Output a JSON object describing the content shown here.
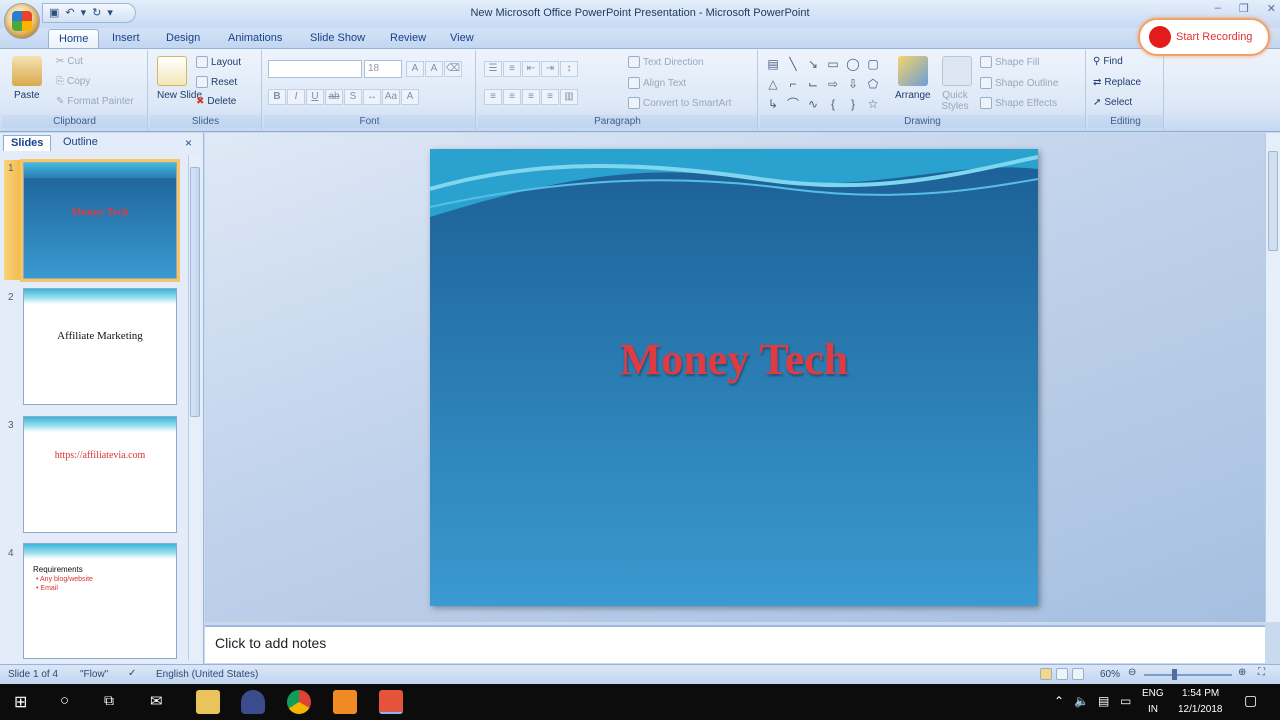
{
  "window": {
    "title": "New Microsoft Office PowerPoint Presentation - Microsoft PowerPoint"
  },
  "tabs": [
    "Home",
    "Insert",
    "Design",
    "Animations",
    "Slide Show",
    "Review",
    "View"
  ],
  "ribbon": {
    "clipboard": {
      "paste": "Paste",
      "cut": "Cut",
      "copy": "Copy",
      "format_painter": "Format Painter",
      "label": "Clipboard"
    },
    "slides": {
      "new_slide": "New Slide",
      "layout": "Layout",
      "reset": "Reset",
      "delete": "Delete",
      "label": "Slides"
    },
    "font": {
      "size": "18",
      "label": "Font"
    },
    "paragraph": {
      "text_direction": "Text Direction",
      "align_text": "Align Text",
      "convert_smartart": "Convert to SmartArt",
      "label": "Paragraph"
    },
    "drawing": {
      "arrange": "Arrange",
      "quick_styles": "Quick Styles",
      "shape_fill": "Shape Fill",
      "shape_outline": "Shape Outline",
      "shape_effects": "Shape Effects",
      "label": "Drawing"
    },
    "editing": {
      "find": "Find",
      "replace": "Replace",
      "select": "Select",
      "label": "Editing"
    }
  },
  "recording": {
    "label": "Start Recording"
  },
  "panel": {
    "tab_slides": "Slides",
    "tab_outline": "Outline"
  },
  "slides": [
    {
      "num": "1",
      "title": "Money Tech"
    },
    {
      "num": "2",
      "title": "Affiliate Marketing"
    },
    {
      "num": "3",
      "title": "https://affiliatevia.com"
    },
    {
      "num": "4",
      "title": "Requirements",
      "bullets": [
        "Any blog/website",
        "Email"
      ]
    }
  ],
  "main_slide": {
    "title": "Money Tech"
  },
  "notes": {
    "placeholder": "Click to add notes"
  },
  "status": {
    "slide": "Slide 1 of 4",
    "theme": "\"Flow\"",
    "language": "English (United States)",
    "zoom": "60%"
  },
  "taskbar": {
    "lang1": "ENG",
    "lang2": "IN",
    "time": "1:54 PM",
    "date": "12/1/2018"
  }
}
